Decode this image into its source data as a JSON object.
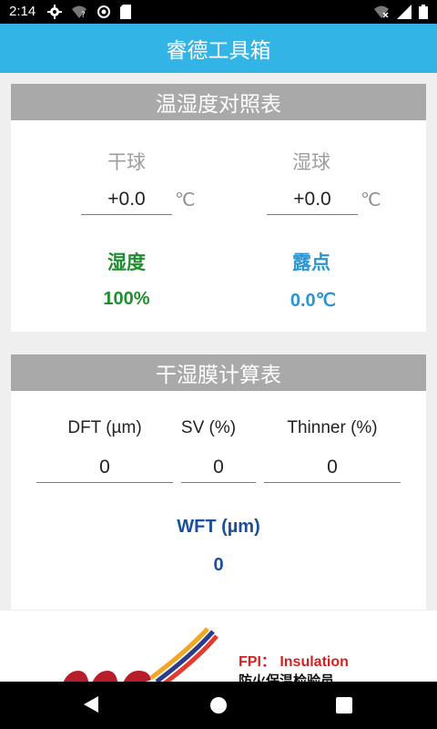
{
  "status": {
    "time": "2:14",
    "left_icons": [
      "gear-icon",
      "wifi-question-icon",
      "sync-disabled-icon",
      "sd-card-icon"
    ],
    "right_icons": [
      "wifi-x-icon",
      "signal-icon",
      "battery-icon"
    ]
  },
  "app": {
    "title": "睿德工具箱",
    "accent": "#33b4e6"
  },
  "humidity_table": {
    "title": "温湿度对照表",
    "dry_bulb": {
      "label": "干球",
      "value": "+0.0",
      "unit": "℃"
    },
    "wet_bulb": {
      "label": "湿球",
      "value": "+0.0",
      "unit": "℃"
    },
    "humidity": {
      "label": "湿度",
      "value": "100%",
      "color": "#1e8e2e"
    },
    "dew_point": {
      "label": "露点",
      "value": "0.0℃",
      "color": "#2a95d0"
    }
  },
  "film_table": {
    "title": "干湿膜计算表",
    "dft": {
      "label": "DFT (µm)",
      "value": "0"
    },
    "sv": {
      "label": "SV (%)",
      "value": "0"
    },
    "thinner": {
      "label": "Thinner (%)",
      "value": "0"
    },
    "wft": {
      "label": "WFT (µm)",
      "value": "0",
      "color": "#1a4f9a"
    }
  },
  "banner": {
    "line1": "FPI：  Insulation",
    "line2": "防火保温检验员",
    "logo_icon": "company-logo-icon"
  },
  "nav": [
    "back-icon",
    "home-icon",
    "recents-icon"
  ]
}
